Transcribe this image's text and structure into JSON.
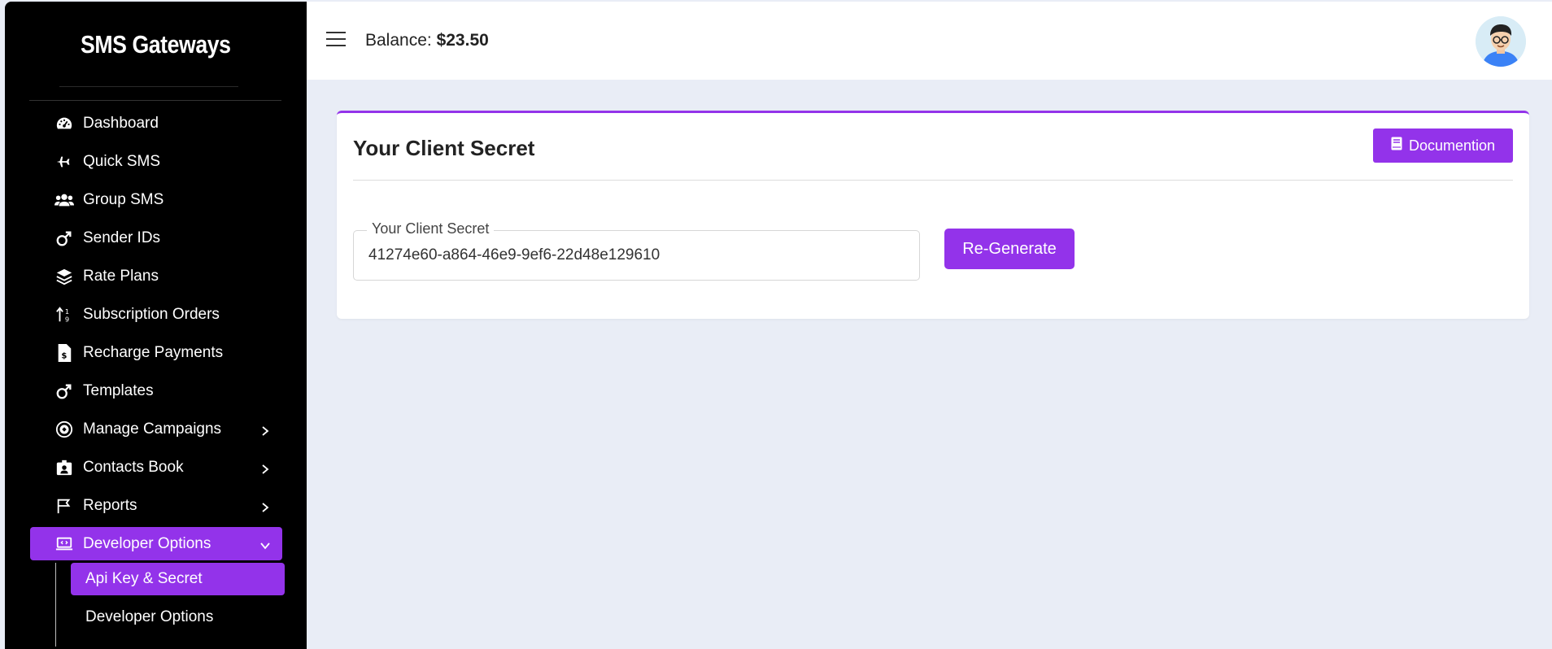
{
  "sidebar": {
    "brand": "SMS Gateways",
    "items": [
      {
        "label": "Dashboard",
        "icon": "dashboard-icon"
      },
      {
        "label": "Quick SMS",
        "icon": "plane-icon"
      },
      {
        "label": "Group SMS",
        "icon": "users-icon"
      },
      {
        "label": "Sender IDs",
        "icon": "male-icon"
      },
      {
        "label": "Rate Plans",
        "icon": "layers-icon"
      },
      {
        "label": "Subscription Orders",
        "icon": "sort-icon"
      },
      {
        "label": "Recharge Payments",
        "icon": "invoice-dollar-icon"
      },
      {
        "label": "Templates",
        "icon": "male-icon"
      },
      {
        "label": "Manage Campaigns",
        "icon": "campaign-icon"
      },
      {
        "label": "Contacts Book",
        "icon": "id-badge-icon"
      },
      {
        "label": "Reports",
        "icon": "flag-icon"
      },
      {
        "label": "Developer Options",
        "icon": "laptop-code-icon"
      }
    ],
    "submenu": [
      {
        "label": "Api Key & Secret"
      },
      {
        "label": "Developer Options"
      }
    ]
  },
  "topbar": {
    "balance_label": "Balance:",
    "balance_value": "$23.50"
  },
  "card": {
    "title": "Your Client Secret",
    "doc_button": "Documention",
    "field_legend": "Your Client Secret",
    "field_value": "41274e60-a864-46e9-9ef6-22d48e129610",
    "regen_button": "Re-Generate"
  },
  "colors": {
    "accent": "#9333ea",
    "sidebar_bg": "#000000",
    "page_bg": "#e9edf6"
  }
}
